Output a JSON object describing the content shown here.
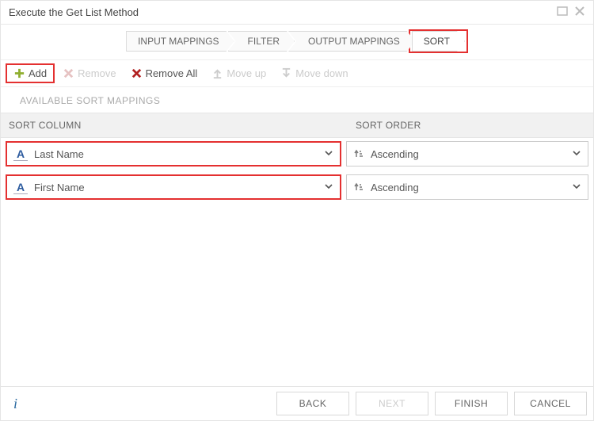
{
  "window": {
    "title": "Execute the Get List Method"
  },
  "steps": [
    {
      "label": "INPUT MAPPINGS",
      "active": false
    },
    {
      "label": "FILTER",
      "active": false
    },
    {
      "label": "OUTPUT MAPPINGS",
      "active": false
    },
    {
      "label": "SORT",
      "active": true
    }
  ],
  "toolbar": {
    "add": "Add",
    "remove": "Remove",
    "remove_all": "Remove All",
    "move_up": "Move up",
    "move_down": "Move down"
  },
  "section_title": "AVAILABLE SORT MAPPINGS",
  "columns": {
    "sort_column": "SORT COLUMN",
    "sort_order": "SORT ORDER"
  },
  "rows": [
    {
      "column": "Last Name",
      "order": "Ascending"
    },
    {
      "column": "First Name",
      "order": "Ascending"
    }
  ],
  "footer": {
    "back": "BACK",
    "next": "NEXT",
    "finish": "FINISH",
    "cancel": "CANCEL"
  }
}
